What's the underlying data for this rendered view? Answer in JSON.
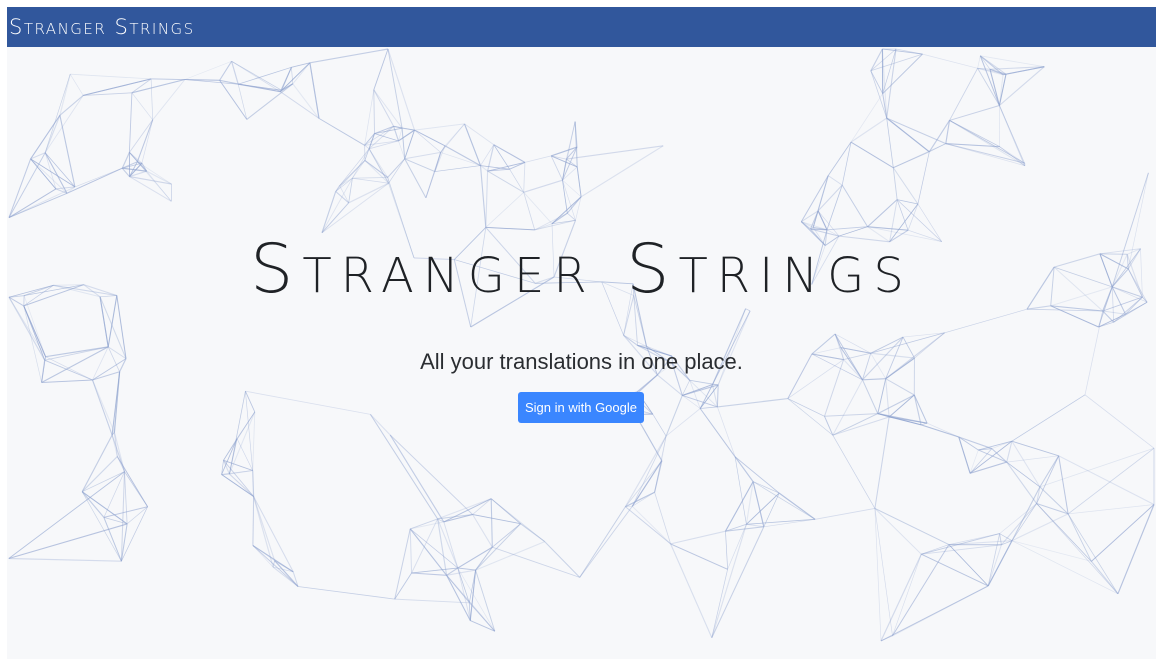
{
  "navbar": {
    "brand": "Stranger Strings"
  },
  "hero": {
    "title": "Stranger Strings",
    "tagline": "All your translations in one place.",
    "sign_in_label": "Sign in with Google"
  },
  "colors": {
    "navbar_bg": "#31579c",
    "page_bg": "#f7f8fa",
    "button_bg": "#3a86ff",
    "network_line": "#8fa3cf"
  },
  "background": {
    "graphic": "network-graph"
  }
}
